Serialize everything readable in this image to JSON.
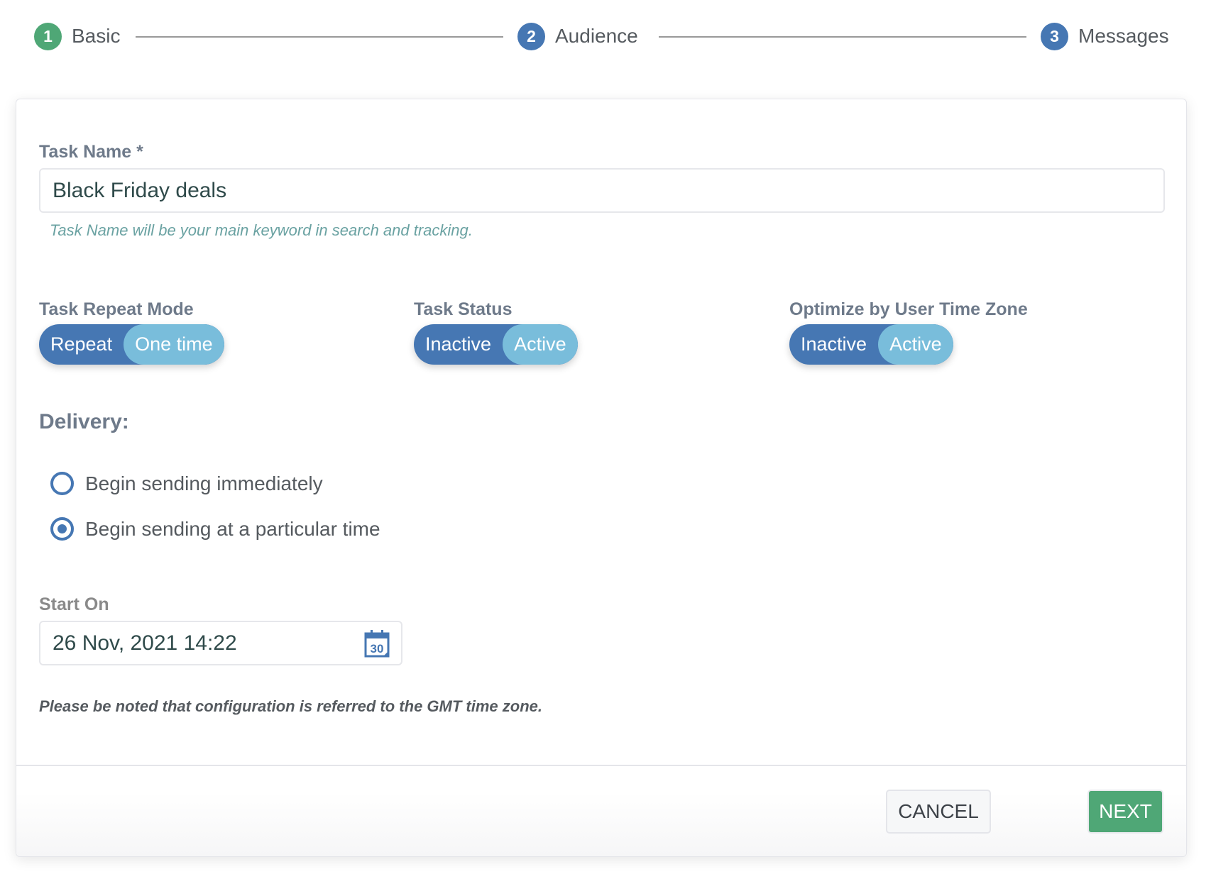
{
  "stepper": {
    "steps": [
      {
        "number": "1",
        "label": "Basic",
        "state": "completed"
      },
      {
        "number": "2",
        "label": "Audience",
        "state": "upcoming"
      },
      {
        "number": "3",
        "label": "Messages",
        "state": "upcoming"
      }
    ]
  },
  "form": {
    "task_name": {
      "label": "Task Name *",
      "value": "Black Friday deals",
      "help": "Task Name will be your main keyword in search and tracking."
    },
    "repeat_mode": {
      "label": "Task Repeat Mode",
      "options": [
        "Repeat",
        "One time"
      ],
      "selected": "One time"
    },
    "task_status": {
      "label": "Task Status",
      "options": [
        "Inactive",
        "Active"
      ],
      "selected": "Active"
    },
    "optimize_tz": {
      "label": "Optimize by User Time Zone",
      "options": [
        "Inactive",
        "Active"
      ],
      "selected": "Active"
    },
    "delivery": {
      "title": "Delivery:",
      "options": [
        {
          "label": "Begin sending immediately",
          "checked": false
        },
        {
          "label": "Begin sending at a particular time",
          "checked": true
        }
      ]
    },
    "start_on": {
      "label": "Start On",
      "value": "26 Nov, 2021 14:22",
      "icon": "calendar-icon",
      "icon_text": "30"
    },
    "note": "Please be noted that configuration is referred to the GMT time zone."
  },
  "footer": {
    "cancel_label": "CANCEL",
    "next_label": "NEXT"
  },
  "colors": {
    "primary": "#4677b3",
    "accent_light": "#79bddb",
    "success": "#4fa776"
  }
}
